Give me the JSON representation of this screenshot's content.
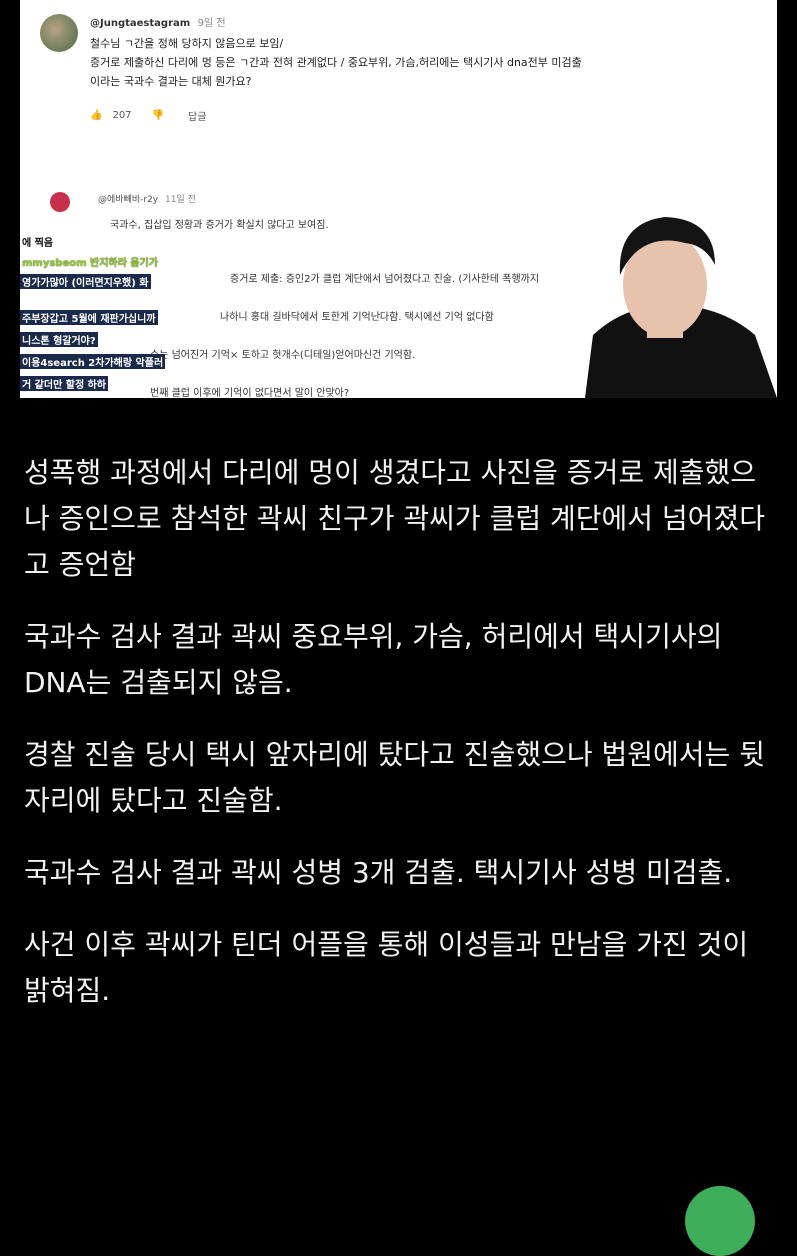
{
  "screenshot": {
    "comment1": {
      "author": "@Jungtaestagram",
      "time": "9일 전",
      "lines": [
        "철수님 ㄱ간을 정해 당하지 않음으로 보임/",
        "증거로 제출하신 다리에 멍 등은 ㄱ간과 전혀 관계없다 / 중요부위, 가슴,허리에는 택시기사 dna전부 미검출",
        "이라는 국과수 결과는 대체 뭔가요?"
      ],
      "likes": "207",
      "reply_label": "답글"
    },
    "comment2": {
      "author": "@에바빼바-r2y",
      "time": "11일 전",
      "lines": [
        "국과수, 집삽입 정황과 증거가 확실치 않다고 보여짐.",
        "증거로 제출: 증인2가 클럽 계단에서 넘어졌다고 진술. (기사한테 폭행까지",
        "나하니 홍대 길바닥에서 토한게 기억난다함. 택시에선 기억 없다함",
        "수는 넘어진거 기억× 토하고 헛개수(디테일)얻어마신건 기억함.",
        "번째 클럽 이후에 기억이 없다면서 말이 안맞아?"
      ]
    },
    "chat": [
      {
        "text": "에 찍음",
        "style": "plain"
      },
      {
        "text": "mmysbeom  반지하라 음기가",
        "style": "yellow"
      },
      {
        "text": "영가가많아 (이러면지우했) 화",
        "style": "hl"
      },
      {
        "text": "주부장갑고  5월에 재판가십니까",
        "style": "hl"
      },
      {
        "text": "니스톤  형갈거야?",
        "style": "hl"
      },
      {
        "text": "이용4search  2차가해랑 악플러",
        "style": "hl"
      },
      {
        "text": "거 같더만 할정 하하",
        "style": "hl"
      }
    ]
  },
  "paragraphs": [
    "성폭행 과정에서 다리에 멍이 생겼다고 사진을 증거로 제출했으나 증인으로 참석한 곽씨 친구가 곽씨가 클럽 계단에서 넘어졌다고 증언함",
    "국과수 검사 결과 곽씨 중요부위, 가슴, 허리에서 택시기사의 DNA는 검출되지 않음.",
    "경찰 진술 당시 택시 앞자리에 탔다고 진술했으나 법원에서는 뒷자리에 탔다고 진술함.",
    "국과수 검사 결과 곽씨 성병 3개 검출. 택시기사 성병 미검출.",
    "사건 이후 곽씨가 틴더 어플을 통해 이성들과 만남을 가진 것이 밝혀짐."
  ]
}
